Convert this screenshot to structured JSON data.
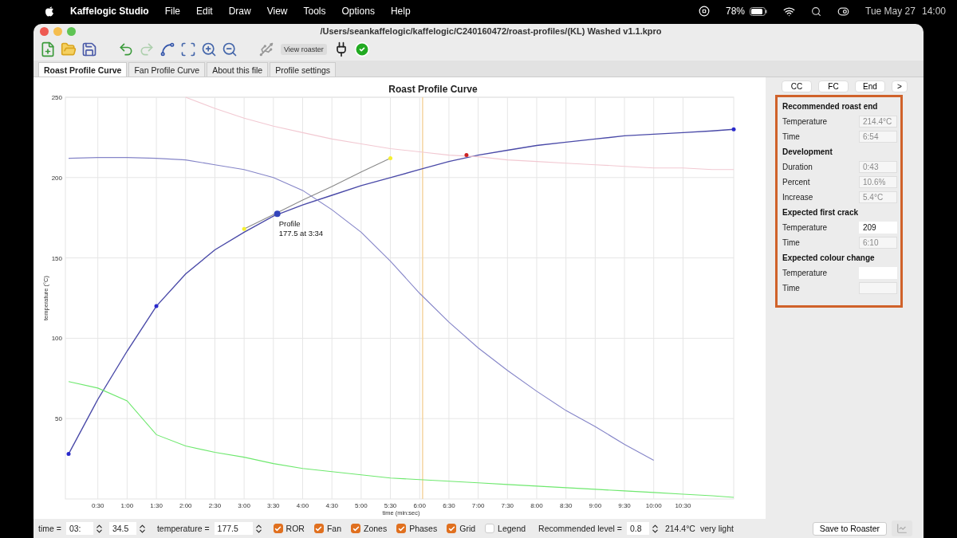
{
  "menubar": {
    "app": "Kaffelogic Studio",
    "menus": [
      "File",
      "Edit",
      "Draw",
      "View",
      "Tools",
      "Options",
      "Help"
    ],
    "battery": "78%",
    "date": "Tue May 27",
    "time": "14:00"
  },
  "window": {
    "title": "/Users/seankaffelogic/kaffelogic/C240160472/roast-profiles/(KL) Washed v1.1.kpro"
  },
  "toolbar": [
    {
      "kind": "icon",
      "disabled": false
    },
    {
      "kind": "icon",
      "disabled": false
    },
    {
      "kind": "icon",
      "disabled": false
    },
    {
      "kind": "gap"
    },
    {
      "kind": "icon",
      "disabled": false
    },
    {
      "kind": "icon",
      "disabled": true
    },
    {
      "kind": "icon",
      "disabled": false
    },
    {
      "kind": "icon",
      "disabled": false
    },
    {
      "kind": "icon",
      "disabled": false
    },
    {
      "kind": "icon",
      "disabled": false
    },
    {
      "kind": "gap"
    },
    {
      "kind": "icon",
      "disabled": false
    },
    {
      "kind": "button",
      "label": "View roaster"
    },
    {
      "kind": "icon",
      "disabled": false
    },
    {
      "kind": "icon",
      "disabled": false
    }
  ],
  "tabs": [
    {
      "label": "Roast Profile Curve",
      "selected": true
    },
    {
      "label": "Fan Profile Curve",
      "selected": false
    },
    {
      "label": "About this file",
      "selected": false
    },
    {
      "label": "Profile settings",
      "selected": false
    }
  ],
  "chart": {
    "chart_data": {
      "type": "line",
      "title": "Roast Profile Curve",
      "xlabel": "time (min:sec)",
      "ylabel": "temperature (°C)",
      "x": [
        0,
        30,
        60,
        90,
        120,
        150,
        180,
        210,
        240,
        270,
        300,
        330,
        360,
        390,
        420,
        450,
        480,
        510,
        540,
        570,
        600,
        630,
        660,
        682
      ],
      "series": [
        {
          "color": "#4a4aa8",
          "values": [
            28,
            62,
            92,
            120,
            140,
            155,
            166,
            176,
            183,
            189,
            195,
            200,
            205,
            210,
            214,
            217,
            220,
            222,
            224,
            226,
            227,
            228,
            229,
            230
          ]
        },
        {
          "color": "#8585c8",
          "values": [
            212,
            212.5,
            212.5,
            212,
            211,
            208,
            205,
            200,
            192,
            180,
            166,
            148,
            128,
            110,
            94,
            80,
            67,
            55,
            45,
            34,
            24,
            null,
            null,
            null
          ]
        },
        {
          "color": "#6ee86e",
          "values": [
            73,
            69,
            61,
            40,
            33,
            29,
            26,
            22,
            19,
            17,
            15,
            13,
            12,
            11,
            10,
            9,
            8,
            7,
            6,
            5,
            4,
            3,
            2,
            1
          ]
        },
        {
          "color": "#f2c9d2",
          "values": [
            null,
            null,
            null,
            null,
            250,
            243,
            237,
            232,
            228,
            224,
            221,
            218,
            216,
            214,
            213,
            211,
            210,
            209,
            208,
            207,
            206,
            206,
            205,
            205
          ]
        },
        {
          "color": "#8a8a8a",
          "values": [
            null,
            null,
            null,
            null,
            null,
            null,
            168,
            177,
            186,
            194.5,
            203.5,
            212,
            null,
            null,
            null,
            null,
            null,
            null,
            null,
            null,
            null,
            null,
            null,
            null
          ]
        }
      ],
      "xlim": [
        0,
        682
      ],
      "ylim": [
        0,
        250
      ],
      "xticks": [
        {
          "value": 30,
          "label": "0:30"
        },
        {
          "value": 60,
          "label": "1:00"
        },
        {
          "value": 90,
          "label": "1:30"
        },
        {
          "value": 120,
          "label": "2:00"
        },
        {
          "value": 150,
          "label": "2:30"
        },
        {
          "value": 180,
          "label": "3:00"
        },
        {
          "value": 210,
          "label": "3:30"
        },
        {
          "value": 240,
          "label": "4:00"
        },
        {
          "value": 270,
          "label": "4:30"
        },
        {
          "value": 300,
          "label": "5:00"
        },
        {
          "value": 330,
          "label": "5:30"
        },
        {
          "value": 360,
          "label": "6:00"
        },
        {
          "value": 390,
          "label": "6:30"
        },
        {
          "value": 420,
          "label": "7:00"
        },
        {
          "value": 450,
          "label": "7:30"
        },
        {
          "value": 480,
          "label": "8:00"
        },
        {
          "value": 510,
          "label": "8:30"
        },
        {
          "value": 540,
          "label": "9:00"
        },
        {
          "value": 570,
          "label": "9:30"
        },
        {
          "value": 600,
          "label": "10:00"
        },
        {
          "value": 630,
          "label": "10:30"
        }
      ],
      "yticks": [
        50,
        100,
        150,
        200,
        250
      ],
      "grid": true,
      "ref_lines": [
        {
          "axis": "x",
          "value": 363
        }
      ],
      "annotations": [
        {
          "text": "Profile",
          "x": 214,
          "y": 177.5
        },
        {
          "text": "177.5 at 3:34",
          "x": 214,
          "y": 177.5
        }
      ]
    }
  },
  "side_buttons": [
    "CC",
    "FC",
    "End",
    ">"
  ],
  "roast_panel": [
    {
      "kind": "heading",
      "label": "Recommended roast end"
    },
    {
      "kind": "field",
      "label": "Temperature",
      "value": "214.4°C",
      "editable": false
    },
    {
      "kind": "field",
      "label": "Time",
      "value": "6:54",
      "editable": false
    },
    {
      "kind": "heading",
      "label": "Development"
    },
    {
      "kind": "field",
      "label": "Duration",
      "value": "0:43",
      "editable": false
    },
    {
      "kind": "field",
      "label": "Percent",
      "value": "10.6%",
      "editable": false
    },
    {
      "kind": "field",
      "label": "Increase",
      "value": "5.4°C",
      "editable": false
    },
    {
      "kind": "heading",
      "label": "Expected first crack"
    },
    {
      "kind": "field",
      "label": "Temperature",
      "value": "209",
      "editable": true
    },
    {
      "kind": "field",
      "label": "Time",
      "value": "6:10",
      "editable": false
    },
    {
      "kind": "heading",
      "label": "Expected colour change"
    },
    {
      "kind": "field",
      "label": "Temperature",
      "editable": true
    },
    {
      "kind": "field",
      "label": "Time",
      "editable": false
    }
  ],
  "status_bar": {
    "time_label": "time =",
    "minutes": "03:",
    "seconds": "34.5",
    "temperature_label": "temperature =",
    "temperature": "177.5",
    "checkboxes": [
      {
        "label": "ROR",
        "checked": true
      },
      {
        "label": "Fan",
        "checked": true
      },
      {
        "label": "Zones",
        "checked": true
      },
      {
        "label": "Phases",
        "checked": true
      },
      {
        "label": "Grid",
        "checked": true
      },
      {
        "label": "Legend",
        "checked": false
      }
    ],
    "level_label": "Recommended level =",
    "level_value": "0.8",
    "reading": "214.4°C",
    "roast_color": "very light",
    "save_button": "Save to Roaster"
  }
}
